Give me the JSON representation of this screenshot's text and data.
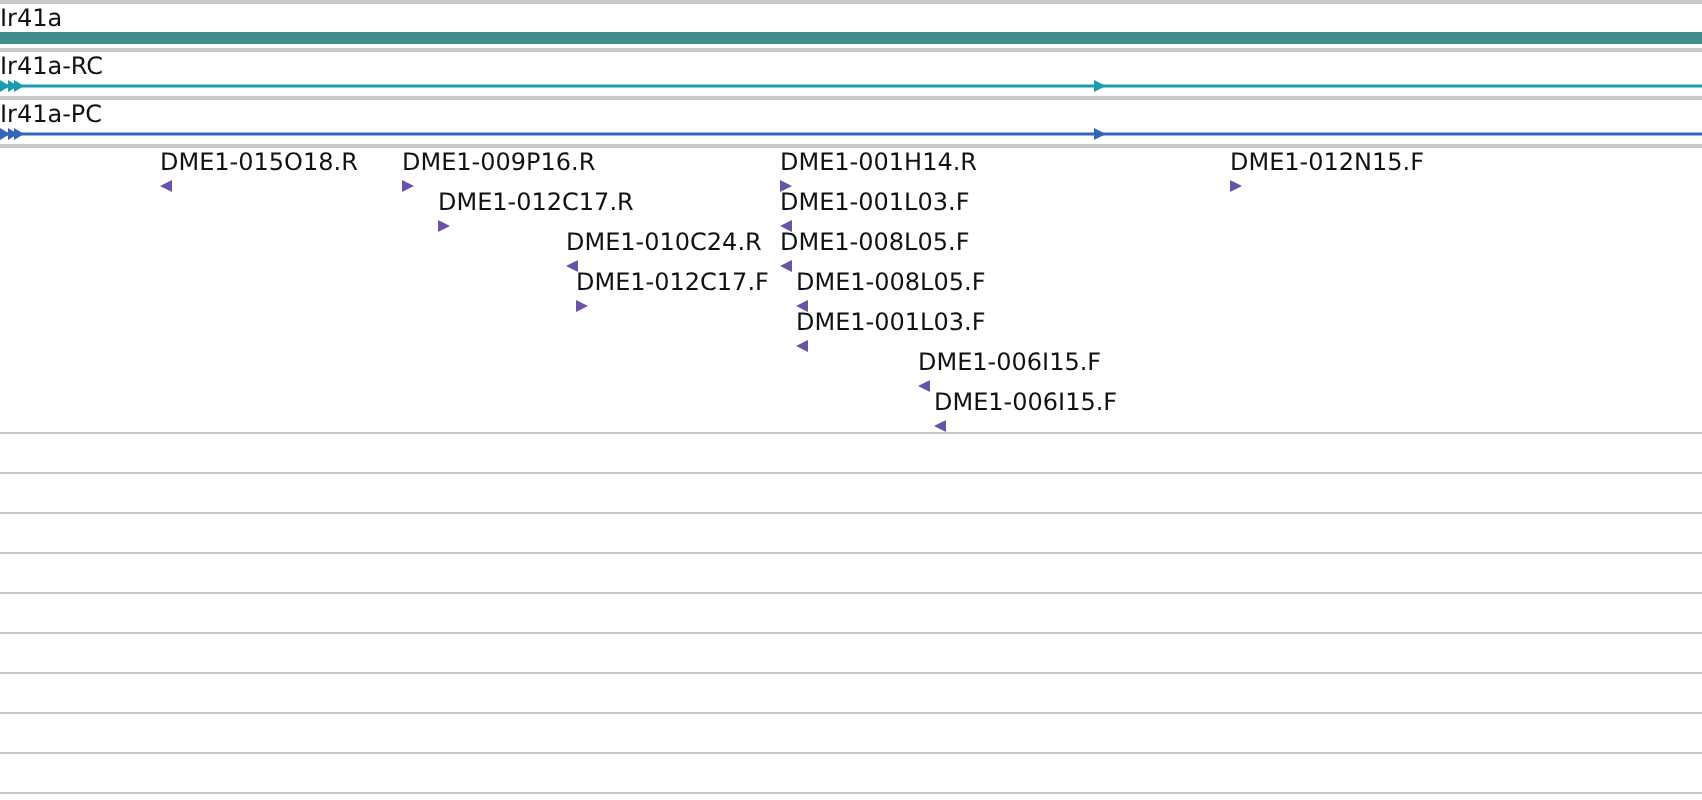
{
  "gene": {
    "label": "Ir41a"
  },
  "transcripts": [
    {
      "label": "Ir41a-RC",
      "color": "#1a9bb0"
    },
    {
      "label": "Ir41a-PC",
      "color": "#3366bb"
    }
  ],
  "features": [
    {
      "label": "DME1-015O18.R",
      "kind": "reverse"
    },
    {
      "label": "DME1-009P16.R",
      "kind": "forward"
    },
    {
      "label": "DME1-001H14.R",
      "kind": "forward"
    },
    {
      "label": "DME1-012N15.F",
      "kind": "forward"
    },
    {
      "label": "DME1-012C17.R",
      "kind": "forward"
    },
    {
      "label": "DME1-001L03.F",
      "kind": "reverse"
    },
    {
      "label": "DME1-010C24.R",
      "kind": "reverse"
    },
    {
      "label": "DME1-008L05.F",
      "kind": "reverse"
    },
    {
      "label": "DME1-012C17.F",
      "kind": "forward"
    },
    {
      "label": "DME1-008L05.F",
      "kind": "reverse"
    },
    {
      "label": "DME1-001L03.F",
      "kind": "reverse"
    },
    {
      "label": "DME1-006I15.F",
      "kind": "reverse"
    },
    {
      "label": "DME1-006I15.F",
      "kind": "reverse"
    }
  ]
}
